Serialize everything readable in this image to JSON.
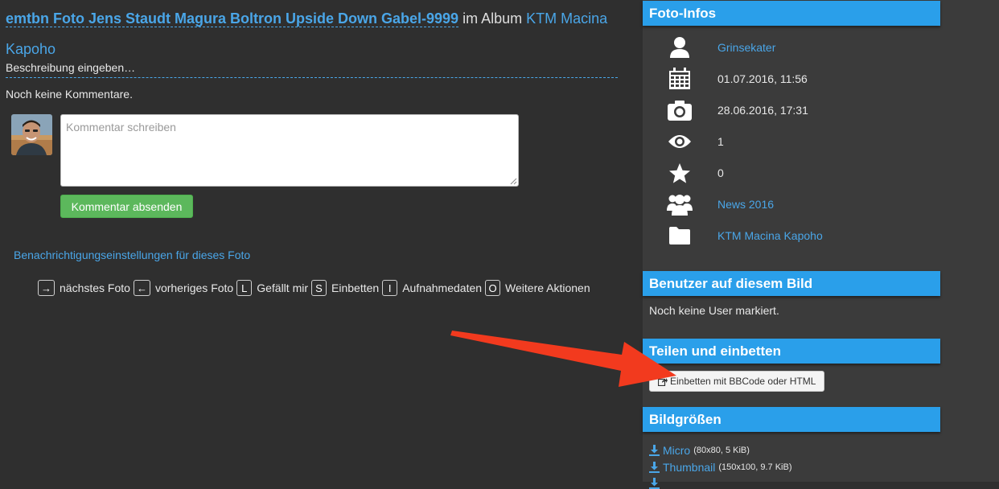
{
  "main": {
    "photo_title": "emtbn Foto Jens Staudt Magura Boltron Upside Down Gabel-9999",
    "album_prefix": " im Album ",
    "album_name": "KTM Macina Kapoho",
    "description_placeholder": "Beschreibung eingeben…",
    "no_comments": "Noch keine Kommentare.",
    "comment_placeholder": "Kommentar schreiben",
    "submit_label": "Kommentar absenden",
    "notify_link": "Benachrichtigungseinstellungen für dieses Foto",
    "shortcuts": [
      {
        "key": "→",
        "label": "nächstes Foto"
      },
      {
        "key": "←",
        "label": "vorheriges Foto"
      },
      {
        "key": "L",
        "label": "Gefällt mir"
      },
      {
        "key": "S",
        "label": "Einbetten"
      },
      {
        "key": "I",
        "label": "Aufnahmedaten"
      },
      {
        "key": "O",
        "label": "Weitere Aktionen"
      }
    ]
  },
  "sidebar": {
    "foto_infos": {
      "title": "Foto-Infos",
      "user": "Grinsekater",
      "uploaded": "01.07.2016, 11:56",
      "taken": "28.06.2016, 17:31",
      "views": "1",
      "likes": "0",
      "group": "News 2016",
      "album": "KTM Macina Kapoho"
    },
    "users": {
      "title": "Benutzer auf diesem Bild",
      "none": "Noch keine User markiert."
    },
    "share": {
      "title": "Teilen und einbetten",
      "embed_label": "Einbetten mit BBCode oder HTML"
    },
    "sizes": {
      "title": "Bildgrößen",
      "items": [
        {
          "name": "Micro",
          "meta": "(80x80, 5 KiB)"
        },
        {
          "name": "Thumbnail",
          "meta": "(150x100, 9.7 KiB)"
        }
      ]
    }
  },
  "colors": {
    "accent": "#2a9fea",
    "link": "#4aa6e8",
    "submit": "#5cb85c",
    "arrow": "#f23a1e"
  }
}
